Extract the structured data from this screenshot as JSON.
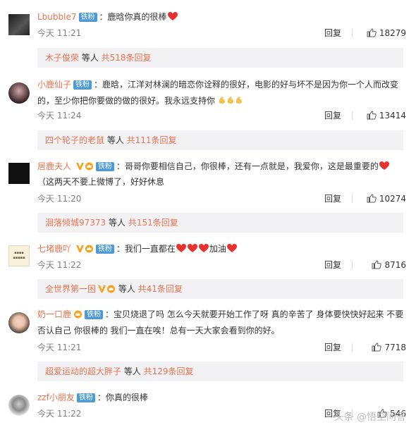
{
  "comments": [
    {
      "user": "Lbubble7",
      "badge": "铁粉",
      "text": "：鹿晗你真的很棒",
      "time": "今天 11:21",
      "reply": "回复",
      "likes": "18279",
      "sub": {
        "name": "木子俊荣",
        "mid": " 等人 ",
        "more": "共518条回复"
      }
    },
    {
      "user": "小鹿仙子",
      "badge": "铁粉",
      "text1": "：鹿晗，江洋对林澜的暗恋你诠释的很好，电影的好与坏不是因为你一个人而改变",
      "text2": "的，至少你把你要做的做的很好。我永远支持你",
      "time": "今天 11:24",
      "reply": "回复",
      "likes": "13414",
      "sub": {
        "name": "四个轮子的老鼠",
        "mid": " 等人 ",
        "more": "共111条回复"
      }
    },
    {
      "user": "居鹿夫人",
      "badge": "铁粉",
      "text1": "：哥哥你要相信自己，你很棒，还有一点就是，我爱你，这是最重要的",
      "text2": "（这两天不要上微博了，好好休息",
      "time": "今天 11:20",
      "reply": "回复",
      "likes": "10274",
      "sub": {
        "name": "洄落倾城97373",
        "mid": " 等人 ",
        "more": "共151条回复"
      }
    },
    {
      "user": "七堵鹿吖",
      "badge": "铁粉",
      "text": "：我们一直都在",
      "text_b": "加油",
      "time": "今天 11:22",
      "reply": "回复",
      "likes": "8716",
      "sub": {
        "name": "全世界第一困",
        "mid": " 等人 ",
        "more": "共41条回复"
      }
    },
    {
      "user": "奶一口鹿",
      "badge": "铁粉",
      "text1": "：宝贝烧退了吗 怎么今天就要开始工作了呀 真的辛苦了 身体要快快好起来 不要",
      "text2": "否认自己 你很棒的 我们一直在唉！总有一天大家会看到你的好。",
      "time": "今天 11:21",
      "reply": "回复",
      "likes": "7718",
      "sub": {
        "name": "超爱运动的超大胖子",
        "mid": " 等人 ",
        "more": "共129条回复"
      }
    },
    {
      "user": "zzf小朋友",
      "badge": "铁粉",
      "text": "：你真的很棒",
      "time": "今天 11:22",
      "reply": "回复",
      "likes": "546"
    }
  ],
  "watermark": "头条 @悟空问答",
  "colors": {
    "accent": "#eb7350",
    "badge": "#4d9bd6",
    "sub_bg": "#f2f2f5",
    "heart": "#e8322f"
  }
}
